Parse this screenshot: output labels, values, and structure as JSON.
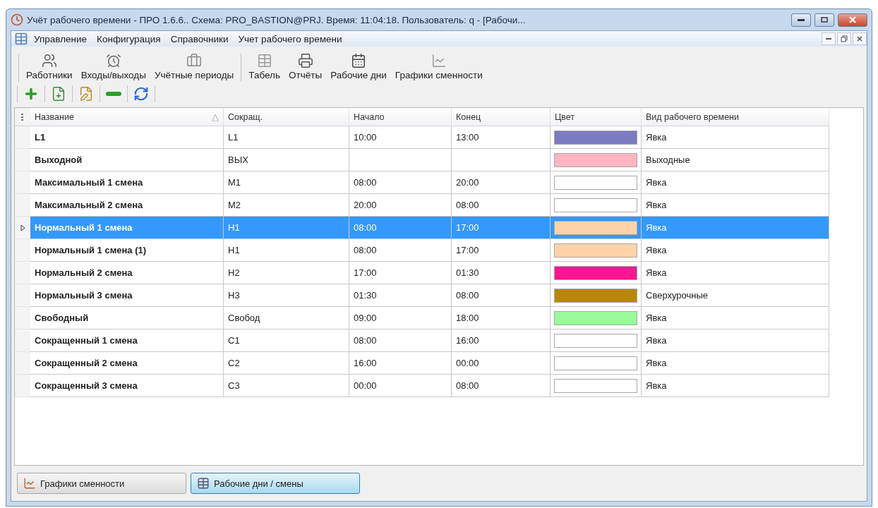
{
  "window": {
    "title": "Учёт рабочего времени - ПРО 1.6.6.. Схема: PRO_BASTION@PRJ. Время: 11:04:18. Пользователь: q - [Рабочи..."
  },
  "menu": [
    "Управление",
    "Конфигурация",
    "Справочники",
    "Учет рабочего времени"
  ],
  "toolbar": [
    {
      "buttons": [
        {
          "label": "Работники",
          "kind": "users"
        },
        {
          "label": "Входы/выходы",
          "kind": "clock"
        },
        {
          "label": "Учётные периоды",
          "kind": "briefcase"
        }
      ]
    },
    {
      "buttons": [
        {
          "label": "Табель",
          "kind": "table"
        },
        {
          "label": "Отчёты",
          "kind": "printer"
        },
        {
          "label": "Рабочие дни",
          "kind": "calendar"
        },
        {
          "label": "Графики сменности",
          "kind": "chart"
        }
      ]
    }
  ],
  "actions": [
    {
      "kind": "add"
    },
    {
      "kind": "new"
    },
    {
      "kind": "edit"
    },
    {
      "kind": "remove"
    },
    {
      "kind": "refresh"
    }
  ],
  "table": {
    "columns": [
      {
        "label": "Название",
        "sort_indicator": "△"
      },
      {
        "label": "Сокращ."
      },
      {
        "label": "Начало"
      },
      {
        "label": "Конец"
      },
      {
        "label": "Цвет"
      },
      {
        "label": "Вид рабочего времени"
      }
    ],
    "rows": [
      {
        "name": "L1",
        "abbr": "L1",
        "start": "10:00",
        "end": "13:00",
        "color": "#7b7bc4",
        "type": "Явка",
        "selected": false
      },
      {
        "name": "Выходной",
        "abbr": "ВЫХ",
        "color": "#ffb6c1",
        "type": "Выходные",
        "selected": false
      },
      {
        "name": "Максимальный 1 смена",
        "abbr": "М1",
        "start": "08:00",
        "end": "20:00",
        "color": "#ffffff",
        "type": "Явка",
        "selected": false
      },
      {
        "name": "Максимальный 2 смена",
        "abbr": "М2",
        "start": "20:00",
        "end": "08:00",
        "color": "#ffffff",
        "type": "Явка",
        "selected": false
      },
      {
        "name": "Нормальный 1 смена",
        "abbr": "Н1",
        "start": "08:00",
        "end": "17:00",
        "color": "#ffd3a8",
        "type": "Явка",
        "selected": true
      },
      {
        "name": "Нормальный 1 смена (1)",
        "abbr": "Н1",
        "start": "08:00",
        "end": "17:00",
        "color": "#ffd3a8",
        "type": "Явка",
        "selected": false
      },
      {
        "name": "Нормальный 2 смена",
        "abbr": "Н2",
        "start": "17:00",
        "end": "01:30",
        "color": "#ff1493",
        "type": "Явка",
        "selected": false
      },
      {
        "name": "Нормальный 3 смена",
        "abbr": "Н3",
        "start": "01:30",
        "end": "08:00",
        "color": "#b8860b",
        "type": "Сверхурочные",
        "selected": false
      },
      {
        "name": "Свободный",
        "abbr": "Свобод",
        "start": "09:00",
        "end": "18:00",
        "color": "#98fb98",
        "type": "Явка",
        "selected": false
      },
      {
        "name": "Сокращенный 1 смена",
        "abbr": "С1",
        "start": "08:00",
        "end": "16:00",
        "color": "#ffffff",
        "type": "Явка",
        "selected": false
      },
      {
        "name": "Сокращенный 2 смена",
        "abbr": "С2",
        "start": "16:00",
        "end": "00:00",
        "color": "#ffffff",
        "type": "Явка",
        "selected": false
      },
      {
        "name": "Сокращенный 3 смена",
        "abbr": "С3",
        "start": "00:00",
        "end": "08:00",
        "color": "#ffffff",
        "type": "Явка",
        "selected": false
      }
    ]
  },
  "bottom_tabs": [
    {
      "label": "Графики сменности",
      "kind": "chart",
      "selected": false
    },
    {
      "label": "Рабочие дни / смены",
      "kind": "table",
      "selected": true
    }
  ]
}
